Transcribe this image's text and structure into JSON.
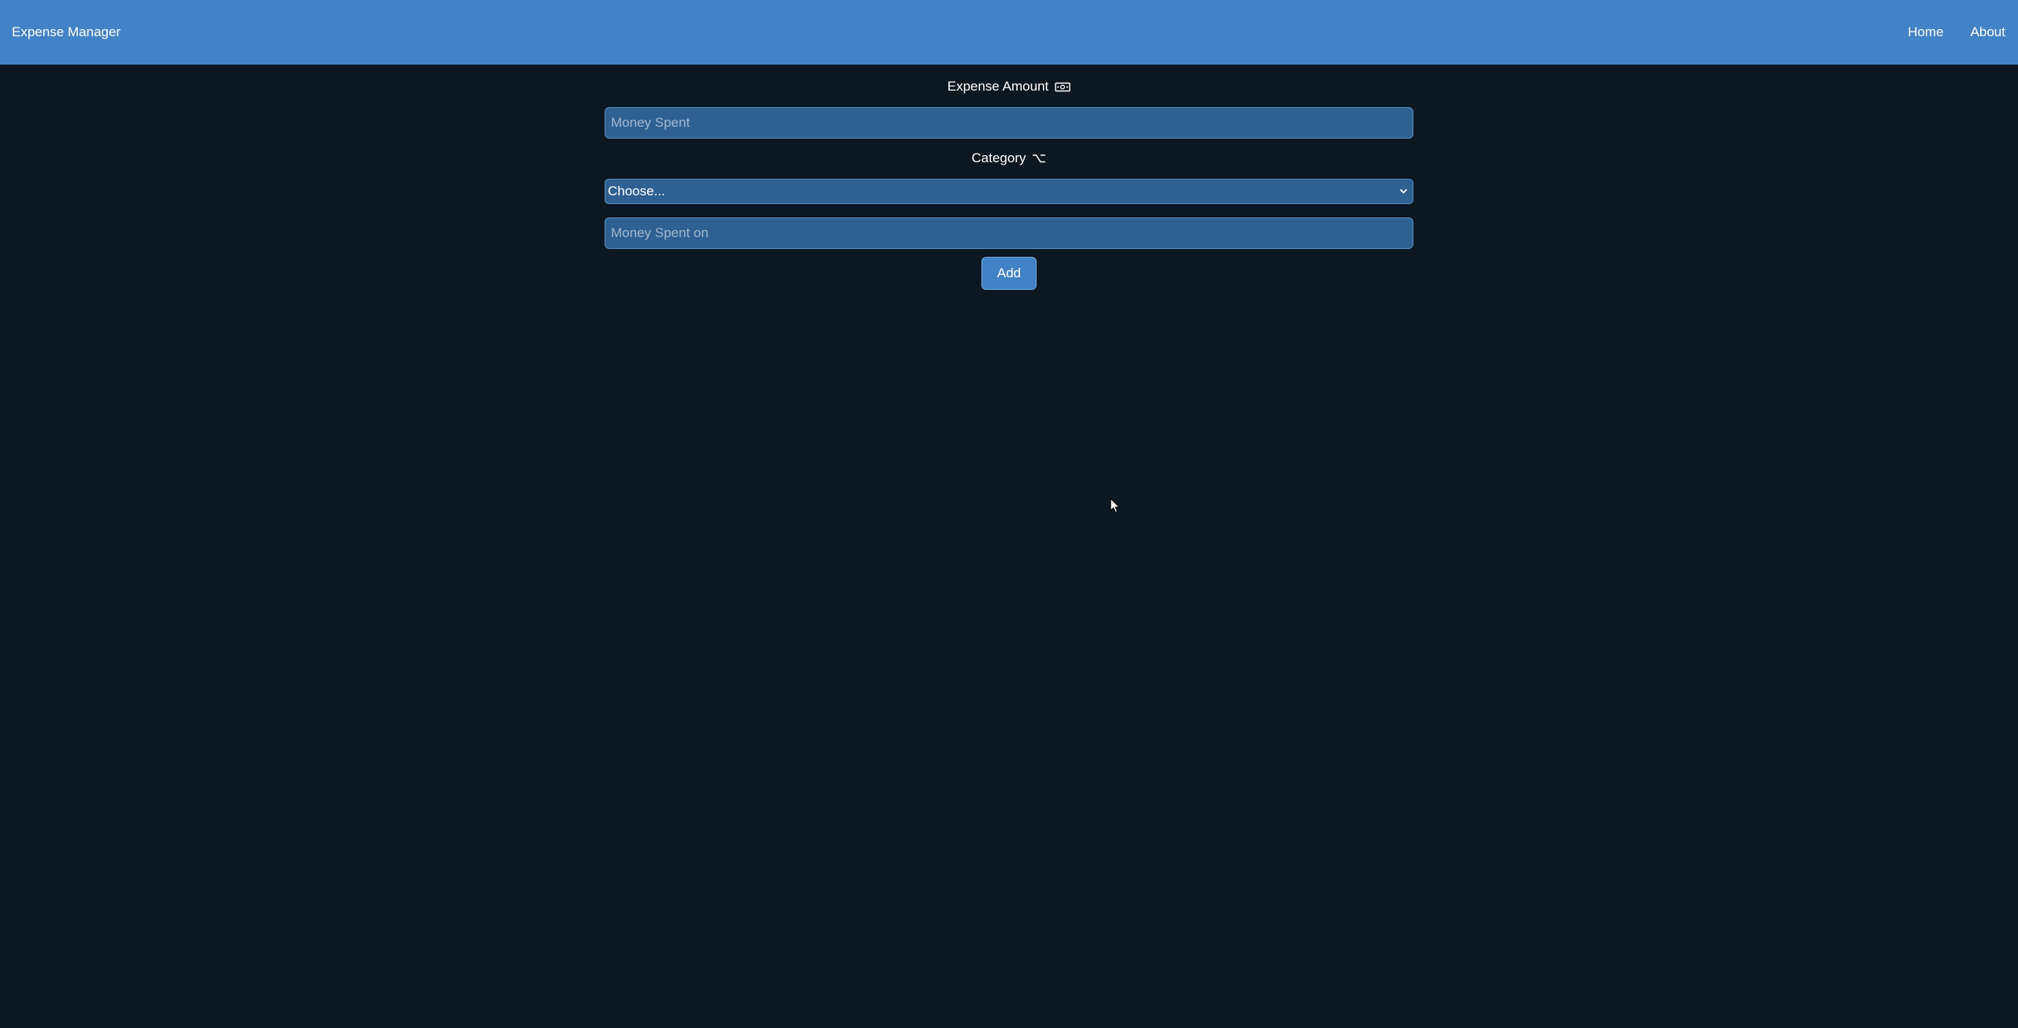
{
  "navbar": {
    "brand": "Expense Manager",
    "links": [
      "Home",
      "About"
    ]
  },
  "form": {
    "amount_label": "Expense Amount",
    "amount_icon": "money-bill-icon",
    "amount_placeholder": "Money Spent",
    "category_label": "Category",
    "category_icon": "option-key-icon",
    "category_selected": "Choose...",
    "description_placeholder": "Money Spent on",
    "add_label": "Add"
  },
  "colors": {
    "navbar": "#4382c6",
    "background": "#0b1821",
    "field": "#2e6192",
    "button": "#4382c6"
  }
}
